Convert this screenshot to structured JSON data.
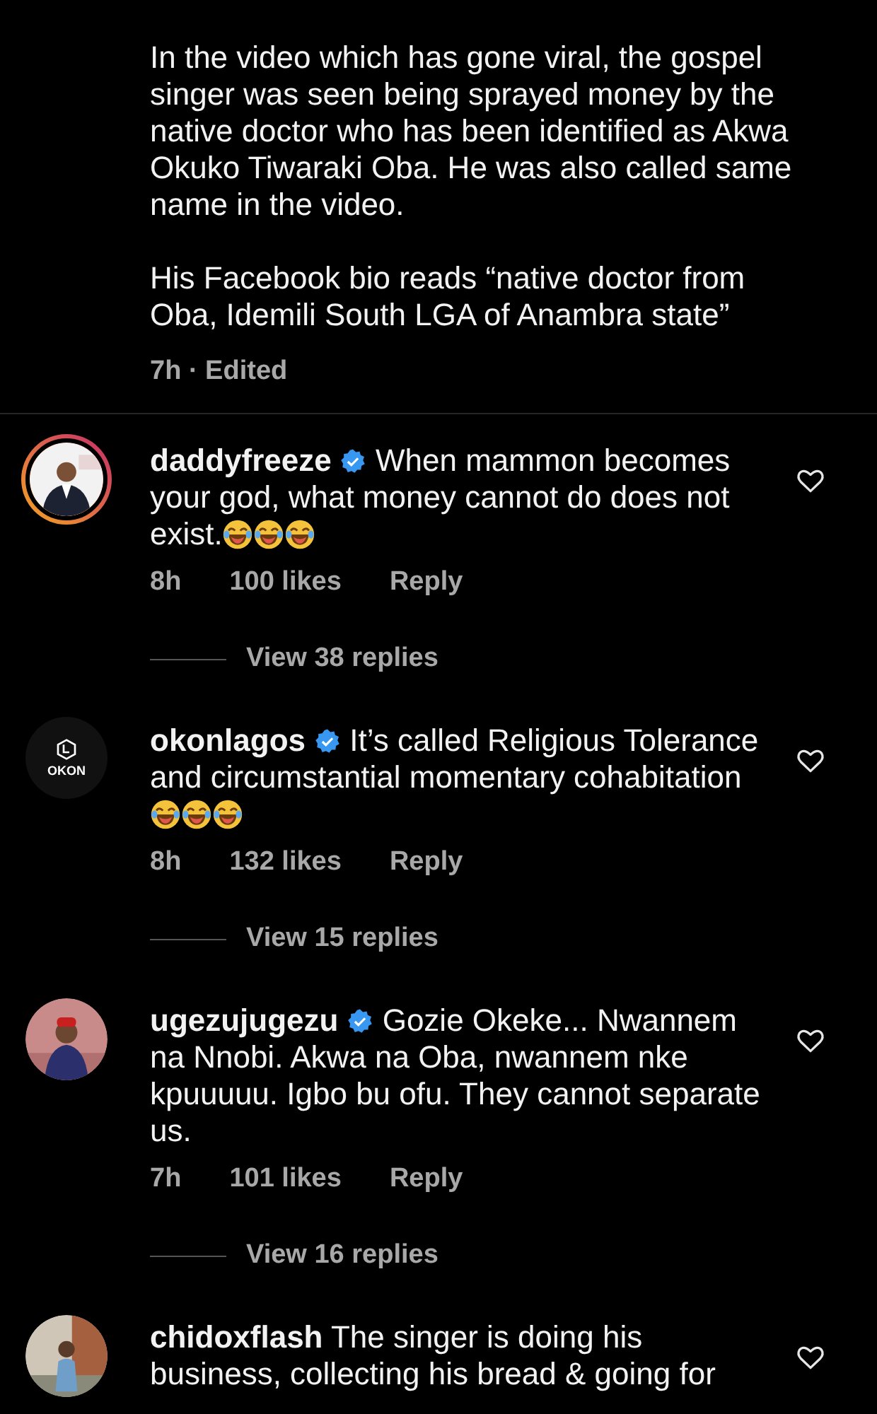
{
  "caption": {
    "paragraphs": [
      "In the video which has gone viral, the gospel singer was seen being sprayed money by the native doctor who has been identified as Akwa Okuko Tiwaraki Oba. He was also called same name in the video.",
      "His Facebook bio reads “native doctor from Oba, Idemili South LGA of Anambra state”"
    ],
    "time": "7h · Edited"
  },
  "comments": [
    {
      "avatar": {
        "kind": "picture",
        "story_ring": true
      },
      "username": "daddyfreeze",
      "verified": true,
      "text": "When mammon becomes your god, what money cannot do does not exist.",
      "emojis": [
        {
          "kind": "laughing"
        },
        {
          "kind": "laughing"
        },
        {
          "kind": "laughing"
        }
      ],
      "time": "8h",
      "likes": "100 likes",
      "reply": "Reply",
      "view_replies": "View 38 replies"
    },
    {
      "avatar": {
        "kind": "logo",
        "label": "OKON",
        "story_ring": false
      },
      "username": "okonlagos",
      "verified": true,
      "text": "It’s called Religious Tolerance and circumstantial momentary cohabitation",
      "emojis": [
        {
          "kind": "laughing"
        },
        {
          "kind": "laughing"
        },
        {
          "kind": "laughing"
        }
      ],
      "time": "8h",
      "likes": "132 likes",
      "reply": "Reply",
      "view_replies": "View 15 replies"
    },
    {
      "avatar": {
        "kind": "picture",
        "story_ring": false
      },
      "username": "ugezujugezu",
      "verified": true,
      "text": "Gozie Okeke... Nwannem na Nnobi. Akwa na Oba, nwannem nke kpuuuuu. Igbo bu ofu. They cannot separate us.",
      "time": "7h",
      "likes": "101 likes",
      "reply": "Reply",
      "view_replies": "View 16 replies"
    },
    {
      "avatar": {
        "kind": "picture",
        "story_ring": false
      },
      "username": "chidoxflash",
      "verified": false,
      "text": "The singer is doing his business, collecting his bread & going for"
    }
  ]
}
